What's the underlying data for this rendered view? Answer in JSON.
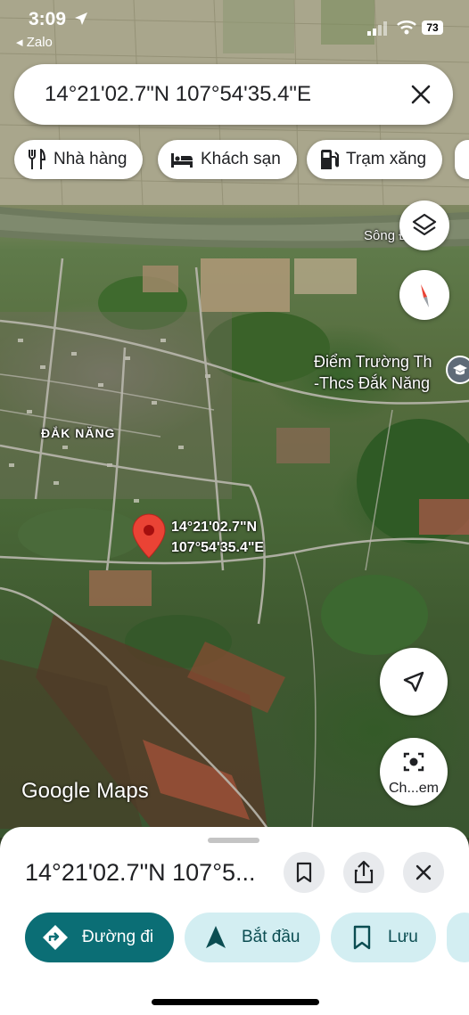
{
  "status_bar": {
    "time": "3:09",
    "back_app": "◂ Zalo",
    "battery": "73"
  },
  "search": {
    "value": "14°21'02.7\"N 107°54'35.4\"E"
  },
  "chips": [
    {
      "label": "Nhà hàng",
      "icon": "restaurant-icon"
    },
    {
      "label": "Khách sạn",
      "icon": "hotel-icon"
    },
    {
      "label": "Trạm xăng",
      "icon": "gas-station-icon"
    }
  ],
  "map": {
    "river_label": "Sông Đa Kla",
    "school_label_line1": "Điểm Trường Th",
    "school_label_line2": "-Thcs Đắk Năng",
    "place_label": "ĐẮK NĂNG",
    "pin_label_line1": "14°21'02.7\"N",
    "pin_label_line2": "107°54'35.4\"E",
    "watermark_google": "Google",
    "watermark_maps": "Maps",
    "lens_label": "Ch...em"
  },
  "sheet": {
    "title": "14°21'02.7\"N 107°5...",
    "actions": [
      {
        "label": "Đường đi",
        "icon": "directions-icon"
      },
      {
        "label": "Bắt đầu",
        "icon": "navigation-arrow-icon"
      },
      {
        "label": "Lưu",
        "icon": "bookmark-icon"
      }
    ]
  },
  "colors": {
    "accent_teal": "#0b6e75",
    "action_light": "#d3eef2",
    "pin_red": "#ea4335"
  }
}
